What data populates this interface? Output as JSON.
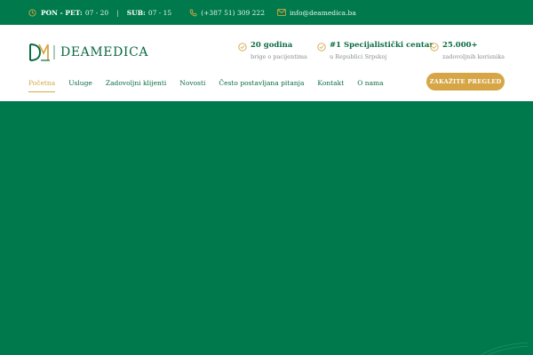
{
  "topbar": {
    "hours_weekday_label": "PON - PET:",
    "hours_weekday_value": "07 - 20",
    "separator": "|",
    "hours_saturday_label": "SUB:",
    "hours_saturday_value": "07 - 15",
    "phone": "(+387 51) 309 222",
    "email": "info@deamedica.ba",
    "icons": [
      "clock-icon",
      "phone-icon",
      "mail-icon"
    ]
  },
  "header": {
    "logo_text": "DEAMEDICA",
    "highlights": [
      {
        "title": "20 godina",
        "subtitle": "brige o pacijentima"
      },
      {
        "title": "#1 Specijalistički centar",
        "subtitle": "u Republici Srpskoj"
      },
      {
        "title": "25.000+",
        "subtitle": "zadovoljnih korisnika"
      }
    ]
  },
  "nav": {
    "items": [
      "Početna",
      "Usluge",
      "Zadovoljni klijenti",
      "Novosti",
      "Često postavljana pitanja",
      "Kontakt",
      "O nama"
    ],
    "active": "Početna"
  },
  "cta": {
    "label": "ZAKAŽITE PREGLED"
  },
  "colors": {
    "brand_green": "#007a4d",
    "accent_gold": "#d6a646",
    "text_green": "#0b6b43",
    "muted_gray": "#8a8f8c"
  }
}
